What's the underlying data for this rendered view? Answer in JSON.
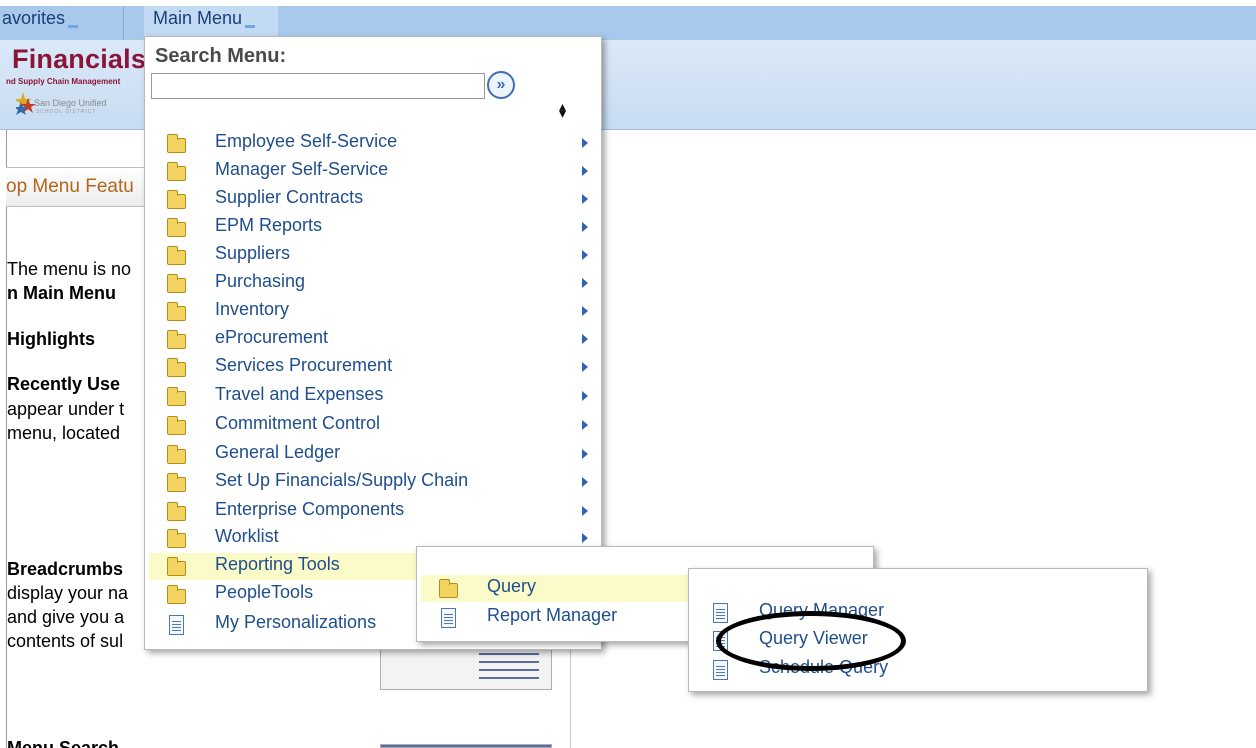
{
  "topnav": {
    "favorites_label": "avorites",
    "main_menu_label": "Main Menu"
  },
  "header": {
    "title": "Financials",
    "subtitle": "nd Supply Chain Management",
    "logo_text": "San Diego Unified",
    "logo_subtext": "SCHOOL DISTRICT"
  },
  "page": {
    "tab_label": "op Menu Featu",
    "lines": [
      {
        "text": "The menu is no",
        "bold": false
      },
      {
        "text": "n Main Menu",
        "bold": true
      },
      {
        "text": "Highlights",
        "bold": true
      },
      {
        "text": "Recently Use",
        "bold": true
      },
      {
        "text": "appear under t",
        "bold": false
      },
      {
        "text": "menu, located",
        "bold": false
      },
      {
        "text": "Breadcrumbs",
        "bold": true
      },
      {
        "text": "display your na",
        "bold": false
      },
      {
        "text": "and give you a",
        "bold": false
      },
      {
        "text": "contents of sul",
        "bold": false
      },
      {
        "text": "Menu Search",
        "bold": true
      }
    ]
  },
  "menu": {
    "title": "Search Menu:",
    "search_value": "",
    "go_label": "»",
    "items": [
      {
        "label": "Employee Self-Service",
        "icon": "folder-icon",
        "has_submenu": true
      },
      {
        "label": "Manager Self-Service",
        "icon": "folder-icon",
        "has_submenu": true
      },
      {
        "label": "Supplier Contracts",
        "icon": "folder-icon",
        "has_submenu": true
      },
      {
        "label": "EPM Reports",
        "icon": "folder-icon",
        "has_submenu": true
      },
      {
        "label": "Suppliers",
        "icon": "folder-icon",
        "has_submenu": true
      },
      {
        "label": "Purchasing",
        "icon": "folder-icon",
        "has_submenu": true
      },
      {
        "label": "Inventory",
        "icon": "folder-icon",
        "has_submenu": true
      },
      {
        "label": "eProcurement",
        "icon": "folder-icon",
        "has_submenu": true
      },
      {
        "label": "Services Procurement",
        "icon": "folder-icon",
        "has_submenu": true
      },
      {
        "label": "Travel and Expenses",
        "icon": "folder-icon",
        "has_submenu": true
      },
      {
        "label": "Commitment Control",
        "icon": "folder-icon",
        "has_submenu": true
      },
      {
        "label": "General Ledger",
        "icon": "folder-icon",
        "has_submenu": true
      },
      {
        "label": "Set Up Financials/Supply Chain",
        "icon": "folder-icon",
        "has_submenu": true
      },
      {
        "label": "Enterprise Components",
        "icon": "folder-icon",
        "has_submenu": true
      },
      {
        "label": "Worklist",
        "icon": "folder-icon",
        "has_submenu": true
      },
      {
        "label": "Reporting Tools",
        "icon": "folder-icon",
        "has_submenu": true,
        "highlighted": true
      },
      {
        "label": "PeopleTools",
        "icon": "folder-icon",
        "has_submenu": false
      },
      {
        "label": "My Personalizations",
        "icon": "document-icon",
        "has_submenu": false
      }
    ]
  },
  "reporting_tools_submenu": {
    "items": [
      {
        "label": "Query",
        "icon": "folder-icon",
        "highlighted": true
      },
      {
        "label": "Report Manager",
        "icon": "document-icon"
      }
    ]
  },
  "query_submenu": {
    "items": [
      {
        "label": "Query Manager",
        "icon": "document-icon"
      },
      {
        "label": "Query Viewer",
        "icon": "document-icon",
        "circled": true
      },
      {
        "label": "Schedule Query",
        "icon": "document-icon"
      }
    ]
  },
  "colors": {
    "menu_link": "#1f4e8c",
    "highlight": "#fbfbc9",
    "brand": "#8a1538",
    "nav_bar": "#a8c9ec"
  }
}
